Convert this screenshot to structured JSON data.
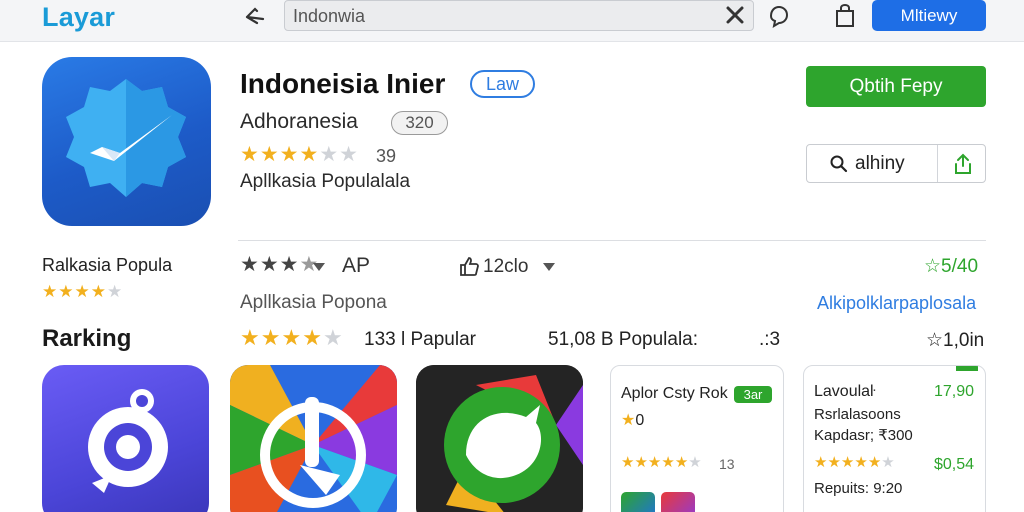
{
  "header": {
    "brand": "Layar",
    "search": {
      "value": "Indonwia",
      "placeholder": ""
    },
    "install_label": "Mltiewy",
    "icons": [
      "back-icon",
      "clear-icon",
      "mic-icon",
      "bag-icon"
    ]
  },
  "app": {
    "title": "Indoneisia Inier",
    "badge": "Law",
    "developer": "Adhoranesia",
    "developer_badge": "320",
    "rating_stars": 3.5,
    "rating_count": "39",
    "category": "Apllkasia Populalala",
    "open_label": "Qbtih Fepy",
    "share_label": "alhiny",
    "icon": "checkmark-badge-icon"
  },
  "sidebar": {
    "category": "Ralkasia Popula",
    "stars": 4,
    "ranking_label": "Rarking"
  },
  "rows": {
    "row1": {
      "stars": 3,
      "ap_label": "AP",
      "count": "12clo",
      "right": "☆5/40"
    },
    "row2": {
      "category": "Apllkasia Popona",
      "link": "Alkipolklarpaplosala"
    },
    "row3": {
      "stars": 4,
      "a": "133 l Papular",
      "b": "51,08 B Populala:",
      "c": ".:3",
      "d": "☆1,0in"
    }
  },
  "cards": [
    {
      "title": "Aplor Csty Rok",
      "chip": "3ar",
      "line2": "0",
      "stars": 4.5,
      "count": "13"
    },
    {
      "title": "Lavoulaŀ",
      "price": "17,90",
      "line2": "Rsrlalasoons",
      "line3": "Kapdasr; ₹300",
      "stars": 4.5,
      "price2": "$0,54",
      "line4": "Repuits: 9:20"
    }
  ],
  "colors": {
    "brand": "#1a9bd7",
    "primary": "#1e6ee6",
    "green": "#2ea52d",
    "star": "#f2b01e"
  }
}
